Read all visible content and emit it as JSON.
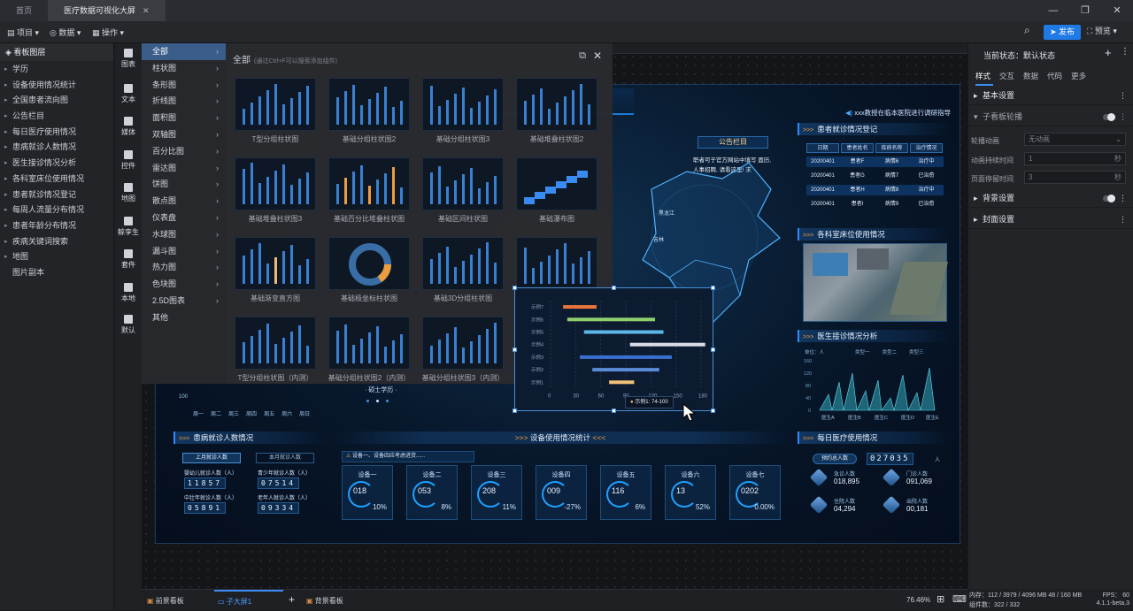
{
  "tabs": [
    {
      "label": "首页"
    },
    {
      "label": "医疗数据可视化大屏"
    }
  ],
  "window_controls": [
    "—",
    "❐",
    "✕"
  ],
  "toolbar": {
    "project": "项目",
    "data": "数据",
    "ops": "操作",
    "publish": "发布",
    "preview": "预览"
  },
  "left_panel": {
    "title": "看板图层",
    "items": [
      "学历",
      "设备使用情况统计",
      "全国患者流向图",
      "公告栏目",
      "每日医疗使用情况",
      "患病就诊人数情况",
      "医生接诊情况分析",
      "各科室床位使用情况",
      "患者就诊情况登记",
      "每周人流量分布情况",
      "患者年龄分布情况",
      "疾病关键词搜索",
      "地图",
      "图片副本"
    ]
  },
  "icon_column": [
    "图表",
    "文本",
    "媒体",
    "控件",
    "地图",
    "鲸孪生",
    "套件",
    "本地",
    "默认"
  ],
  "categories": [
    "全部",
    "柱状图",
    "条形图",
    "折线图",
    "面积图",
    "双轴图",
    "百分比图",
    "雷达图",
    "饼图",
    "散点图",
    "仪表盘",
    "水球图",
    "漏斗图",
    "热力图",
    "色块图",
    "2.5D图表",
    "其他"
  ],
  "gallery": {
    "title": "全部",
    "hint": "(通过Ctrl+F可以搜索添加组件)",
    "items": [
      "T型分组柱状图",
      "基础分组柱状图2",
      "基础分组柱状图3",
      "基础堆叠柱状图2",
      "基础堆叠柱状图3",
      "基础百分比堆叠柱状图",
      "基础区间柱状图",
      "基础瀑布图",
      "基础渐变直方图",
      "基础极坐标柱状图",
      "基础3D分组柱状图",
      "",
      "T型分组柱状图（内测）",
      "基础分组柱状图2（内测）",
      "基础分组柱状图3（内测）",
      ""
    ]
  },
  "screen": {
    "notice_scroll": "xxx教授在临本医院进行调研指导",
    "notice_title": "公告栏目",
    "notice_text": "职者可于官方网站中填写 面历, 人事招聘, 请看这里! 求",
    "panels": {
      "register": "患者就诊情况登记",
      "beds": "各科室床位使用情况",
      "doctor": "医生接诊情况分析",
      "patients": "患病就诊人数情况",
      "devices": "设备使用情况统计",
      "daily": "每日医疗使用情况"
    },
    "register_table": {
      "headers": [
        "日期",
        "患者姓名",
        "疾病名称",
        "治疗情况"
      ],
      "rows": [
        [
          "20200401",
          "患者F",
          "病情6",
          "治疗中"
        ],
        [
          "20200401",
          "患者G",
          "病情7",
          "已治愈"
        ],
        [
          "20200401",
          "患者H",
          "病情8",
          "治疗中"
        ],
        [
          "20200401",
          "患者I",
          "病情9",
          "已治愈"
        ]
      ]
    },
    "map_labels": [
      "黑龙江",
      "吉林"
    ],
    "edu_label": "· 硕士学历 ·",
    "week_labels": [
      "周一",
      "周二",
      "周三",
      "周四",
      "周五",
      "周六",
      "周日"
    ],
    "week_tick": "100",
    "patients": {
      "btn1": "上月就诊人数",
      "btn2": "本月就诊人数",
      "stats": [
        {
          "label": "婴幼儿就诊人数（人）",
          "value": "11857"
        },
        {
          "label": "青少年就诊人数（人）",
          "value": "07514"
        },
        {
          "label": "中壮年就诊人数（人）",
          "value": "05891"
        },
        {
          "label": "老年人就诊人数（人）",
          "value": "09334"
        }
      ]
    },
    "device_alert": "设备一、设备四应考虑进货......",
    "devices": [
      {
        "name": "设备一",
        "value": "018",
        "pct": "10%"
      },
      {
        "name": "设备二",
        "value": "053",
        "pct": "8%"
      },
      {
        "name": "设备三",
        "value": "208",
        "pct": "11%"
      },
      {
        "name": "设备四",
        "value": "009",
        "pct": "-27%"
      },
      {
        "name": "设备五",
        "value": "116",
        "pct": "6%"
      },
      {
        "name": "设备六",
        "value": "13",
        "pct": "52%"
      },
      {
        "name": "设备七",
        "value": "0202",
        "pct": "0.00%"
      }
    ],
    "doctor_chart": {
      "unit": "单位：人",
      "legend": [
        "类型一",
        "类型二",
        "类型三"
      ],
      "yticks": [
        "160",
        "120",
        "80",
        "40",
        "0"
      ],
      "xcats": [
        "医生A",
        "医生B",
        "医生C",
        "医生D",
        "医生E"
      ]
    },
    "daily": {
      "total_label": "预约总人数",
      "total": "027035",
      "unit": "人",
      "stats": [
        {
          "label": "急诊人数",
          "value": "018,895"
        },
        {
          "label": "门诊人数",
          "value": "091,069"
        },
        {
          "label": "住院人数",
          "value": "04,294"
        },
        {
          "label": "出院人数",
          "value": "00,181"
        }
      ]
    }
  },
  "chart_data": {
    "type": "bar",
    "orientation": "horizontal",
    "categories": [
      "示例1",
      "示例2",
      "示例3",
      "示例4",
      "示例5",
      "示例6",
      "示例7"
    ],
    "ranges": [
      [
        70,
        100
      ],
      [
        50,
        130
      ],
      [
        35,
        145
      ],
      [
        95,
        185
      ],
      [
        40,
        135
      ],
      [
        20,
        125
      ],
      [
        15,
        55
      ]
    ],
    "colors": [
      "#f0c07a",
      "#5a8bd6",
      "#3a6fcf",
      "#d9dce6",
      "#5cb8e8",
      "#8fd06c",
      "#e8763a"
    ],
    "xticks": [
      "0",
      "30",
      "60",
      "90",
      "120",
      "150",
      "180"
    ],
    "xlim": [
      0,
      180
    ],
    "tooltip_label": "示例1",
    "tooltip_value": "74-100"
  },
  "right_panel": {
    "state": "当前状态：默认状态",
    "tabs": [
      "样式",
      "交互",
      "数据",
      "代码",
      "更多"
    ],
    "sections": [
      "基本设置",
      "子看板轮播",
      "背景设置",
      "封面设置"
    ],
    "fields": [
      {
        "label": "轮播动画",
        "value": "无动画"
      },
      {
        "label": "动画持续时间",
        "value": "1",
        "unit": "秒"
      },
      {
        "label": "页面停留时间",
        "value": "3",
        "unit": "秒"
      }
    ]
  },
  "bottom": {
    "tabs": [
      "前景看板",
      "子大屏1",
      "背景看板"
    ],
    "zoom": "76.46%"
  },
  "status": {
    "mem": "内存：112 / 3979 / 4096 MB  48 / 160 MB",
    "fps": "FPS： 60",
    "count": "组件数：322 / 332",
    "version": "4.1.1-beta.3"
  }
}
